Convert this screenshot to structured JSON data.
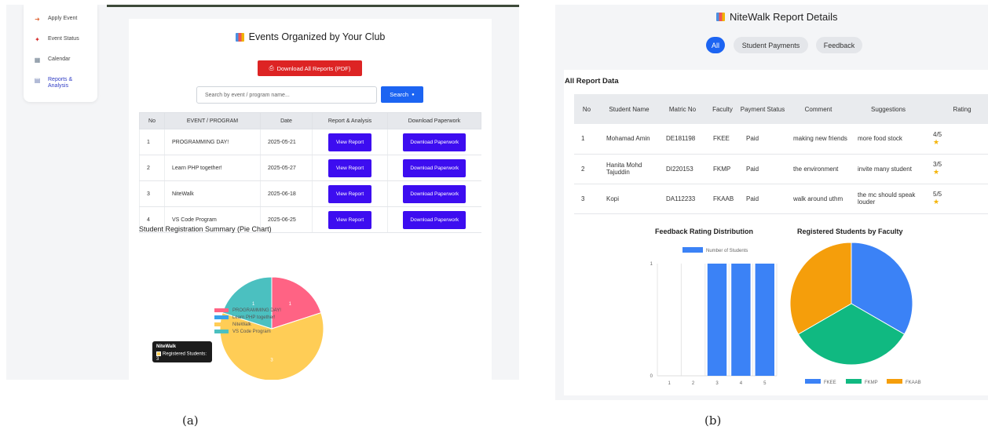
{
  "panel_a": {
    "sidebar": {
      "items": [
        {
          "label": "Apply Event",
          "icon": "apply-event-icon"
        },
        {
          "label": "Event Status",
          "icon": "pin-icon"
        },
        {
          "label": "Calendar",
          "icon": "calendar-icon"
        },
        {
          "label": "Reports &\nAnalysis",
          "icon": "report-icon"
        }
      ]
    },
    "title": "Events Organized by Your Club",
    "download_all_label": "Download All Reports (PDF)",
    "search": {
      "placeholder": "Search by event / program name...",
      "button": "Search"
    },
    "table": {
      "headers": [
        "No",
        "EVENT / PROGRAM",
        "Date",
        "Report & Analysis",
        "Download Paperwork"
      ],
      "rows": [
        {
          "no": "1",
          "event": "PROGRAMMING DAY!",
          "date": "2025-05-21",
          "report": "View Report",
          "download": "Download Paperwork"
        },
        {
          "no": "2",
          "event": "Learn PHP together!",
          "date": "2025-05-27",
          "report": "View Report",
          "download": "Download Paperwork"
        },
        {
          "no": "3",
          "event": "NiteWalk",
          "date": "2025-06-18",
          "report": "View Report",
          "download": "Download Paperwork"
        },
        {
          "no": "4",
          "event": "VS Code Program",
          "date": "2025-06-25",
          "report": "View Report",
          "download": "Download Paperwork"
        }
      ]
    },
    "pie_title": "Student Registration Summary (Pie Chart)",
    "tooltip": {
      "title": "NiteWalk",
      "body": "Registered Students: 3"
    }
  },
  "panel_b": {
    "title": "NiteWalk Report Details",
    "filters": [
      "All",
      "Student Payments",
      "Feedback"
    ],
    "card_title": "All Report Data",
    "table": {
      "headers": [
        "No",
        "Student Name",
        "Matric No",
        "Faculty",
        "Payment Status",
        "Comment",
        "Suggestions",
        "Rating"
      ],
      "rows": [
        {
          "no": "1",
          "name": "Mohamad Amin",
          "matric": "DE181198",
          "faculty": "FKEE",
          "payment": "Paid",
          "comment": "making new friends",
          "suggestion": "more food stock",
          "rating": "4/5"
        },
        {
          "no": "2",
          "name": "Hanita Mohd Tajuddin",
          "matric": "DI220153",
          "faculty": "FKMP",
          "payment": "Paid",
          "comment": "the environment",
          "suggestion": "invite many student",
          "rating": "3/5"
        },
        {
          "no": "3",
          "name": "Kopi",
          "matric": "DA112233",
          "faculty": "FKAAB",
          "payment": "Paid",
          "comment": "walk around uthm",
          "suggestion": "the mc should speak louder",
          "rating": "5/5"
        }
      ]
    },
    "bar_title": "Feedback Rating Distribution",
    "pie_title": "Registered Students by Faculty"
  },
  "labels": {
    "a": "(a)",
    "b": "(b)"
  },
  "chart_data": [
    {
      "type": "pie",
      "title": "Student Registration Summary (Pie Chart)",
      "categories": [
        "PROGRAMMING DAY!",
        "Learn PHP together!",
        "NiteWalk",
        "VS Code Program"
      ],
      "values": [
        1,
        0,
        3,
        1
      ],
      "colors": [
        "#ff6384",
        "#36a2eb",
        "#ffcd56",
        "#4bc0c0"
      ],
      "legend": "right"
    },
    {
      "type": "bar",
      "title": "Feedback Rating Distribution",
      "categories": [
        "1",
        "2",
        "3",
        "4",
        "5"
      ],
      "series": [
        {
          "name": "Number of Students",
          "values": [
            0,
            0,
            1,
            1,
            1
          ]
        }
      ],
      "ylim": [
        0,
        1
      ],
      "yticks": [
        "0",
        "1"
      ],
      "color": "#3b82f6",
      "legend": "top"
    },
    {
      "type": "pie",
      "title": "Registered Students by Faculty",
      "categories": [
        "FKEE",
        "FKMP",
        "FKAAB"
      ],
      "values": [
        1,
        1,
        1
      ],
      "colors": [
        "#3b82f6",
        "#10b981",
        "#f59e0b"
      ],
      "legend": "bottom"
    }
  ]
}
